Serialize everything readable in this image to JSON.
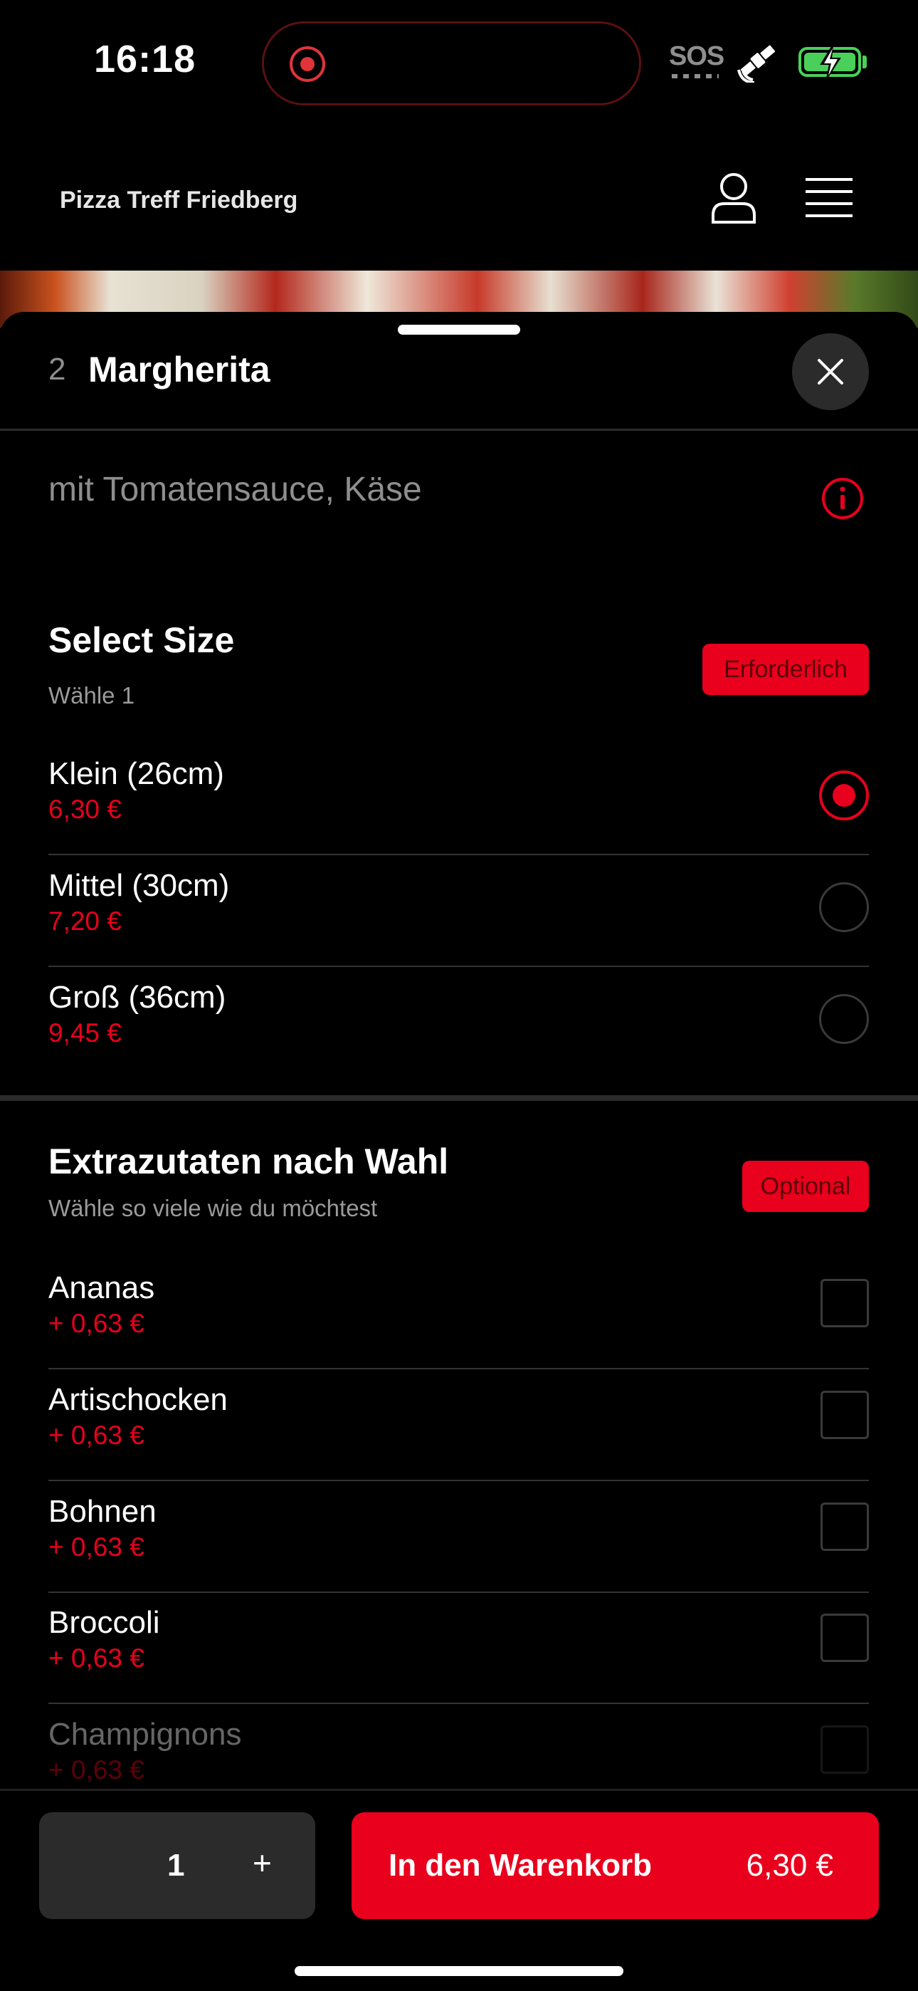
{
  "status_bar": {
    "time": "16:18",
    "sos": "SOS"
  },
  "header": {
    "restaurant_name": "Pizza Treff Friedberg"
  },
  "item": {
    "number": "2",
    "title": "Margherita",
    "description": "mit Tomatensauce, Käse"
  },
  "size_section": {
    "title": "Select Size",
    "subtitle": "Wähle 1",
    "badge": "Erforderlich",
    "options": [
      {
        "name": "Klein (26cm)",
        "price": "6,30 €",
        "selected": true
      },
      {
        "name": "Mittel (30cm)",
        "price": "7,20 €",
        "selected": false
      },
      {
        "name": "Groß (36cm)",
        "price": "9,45 €",
        "selected": false
      }
    ]
  },
  "extras_section": {
    "title": "Extrazutaten nach Wahl",
    "subtitle": "Wähle so viele wie du möchtest",
    "badge": "Optional",
    "options": [
      {
        "name": "Ananas",
        "price": "+ 0,63 €"
      },
      {
        "name": "Artischocken",
        "price": "+ 0,63 €"
      },
      {
        "name": "Bohnen",
        "price": "+ 0,63 €"
      },
      {
        "name": "Broccoli",
        "price": "+ 0,63 €"
      },
      {
        "name": "Champignons",
        "price": "+ 0,63 €"
      }
    ]
  },
  "footer": {
    "quantity": "1",
    "plus": "+",
    "add_to_cart": "In den Warenkorb",
    "total": "6,30 €"
  },
  "colors": {
    "accent": "#e8001c",
    "background": "#000000",
    "surface": "#2b2b2b",
    "battery": "#4ad05a"
  }
}
